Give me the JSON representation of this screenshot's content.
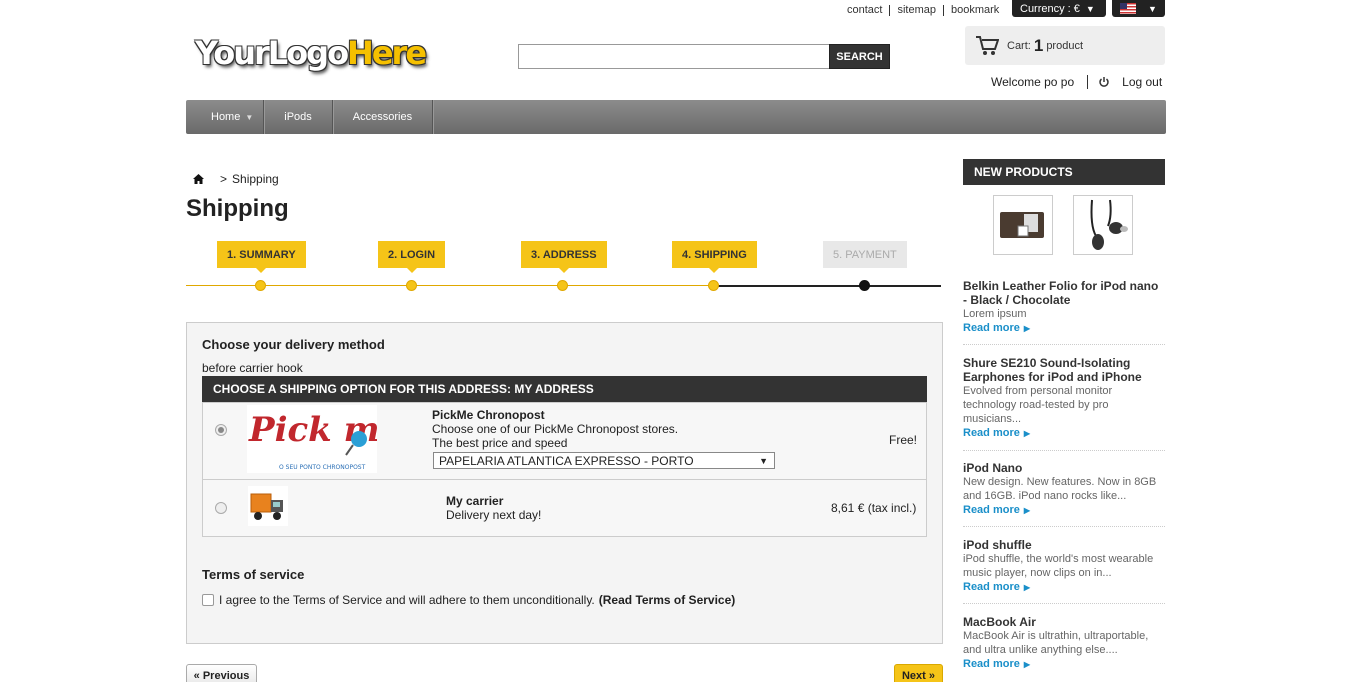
{
  "top_links": [
    "contact",
    "sitemap",
    "bookmark"
  ],
  "currency": "Currency : €",
  "logo": {
    "part1": "YourLogo",
    "part2": "Here"
  },
  "search": {
    "button": "SEARCH",
    "placeholder": ""
  },
  "cart": {
    "label": "Cart:",
    "count": "1",
    "unit": "product"
  },
  "user": {
    "welcome": "Welcome po po",
    "logout": "Log out"
  },
  "nav": [
    "Home",
    "iPods",
    "Accessories"
  ],
  "breadcrumb": {
    "sep": ">",
    "current": "Shipping"
  },
  "page_title": "Shipping",
  "steps": [
    "1. SUMMARY",
    "2. LOGIN",
    "3. ADDRESS",
    "4. SHIPPING",
    "5. PAYMENT"
  ],
  "delivery": {
    "title": "Choose your delivery method",
    "hook": "before carrier hook",
    "header": "CHOOSE A SHIPPING OPTION FOR THIS ADDRESS: MY ADDRESS",
    "carriers": [
      {
        "name": "PickMe Chronopost",
        "desc1": "Choose one of our PickMe Chronopost stores.",
        "desc2": "The best price and speed",
        "store": "PAPELARIA ATLANTICA EXPRESSO - PORTO",
        "price": "Free!",
        "logo_text": "Pick me",
        "logo_sub": "O SEU PONTO CHRONOPOST"
      },
      {
        "name": "My carrier",
        "desc1": "Delivery next day!",
        "price": "8,61 € (tax incl.)"
      }
    ]
  },
  "tos": {
    "title": "Terms of service",
    "text": "I agree to the Terms of Service and will adhere to them unconditionally.",
    "link": "(Read Terms of Service)"
  },
  "buttons": {
    "prev": "« Previous",
    "next": "Next »"
  },
  "sidebar": {
    "title": "NEW PRODUCTS",
    "read_more": "Read more",
    "products": [
      {
        "name": "Belkin Leather Folio for iPod nano - Black / Chocolate",
        "desc": "Lorem ipsum"
      },
      {
        "name": "Shure SE210 Sound-Isolating Earphones for iPod and iPhone",
        "desc": "Evolved from personal monitor technology road-tested by pro musicians..."
      },
      {
        "name": "iPod Nano",
        "desc": "New design. New features. Now in 8GB and 16GB. iPod nano rocks like..."
      },
      {
        "name": "iPod shuffle",
        "desc": "iPod shuffle, the world's most wearable music player, now clips on in..."
      },
      {
        "name": "MacBook Air",
        "desc": "MacBook Air is ultrathin, ultraportable, and ultra unlike anything else...."
      }
    ]
  }
}
